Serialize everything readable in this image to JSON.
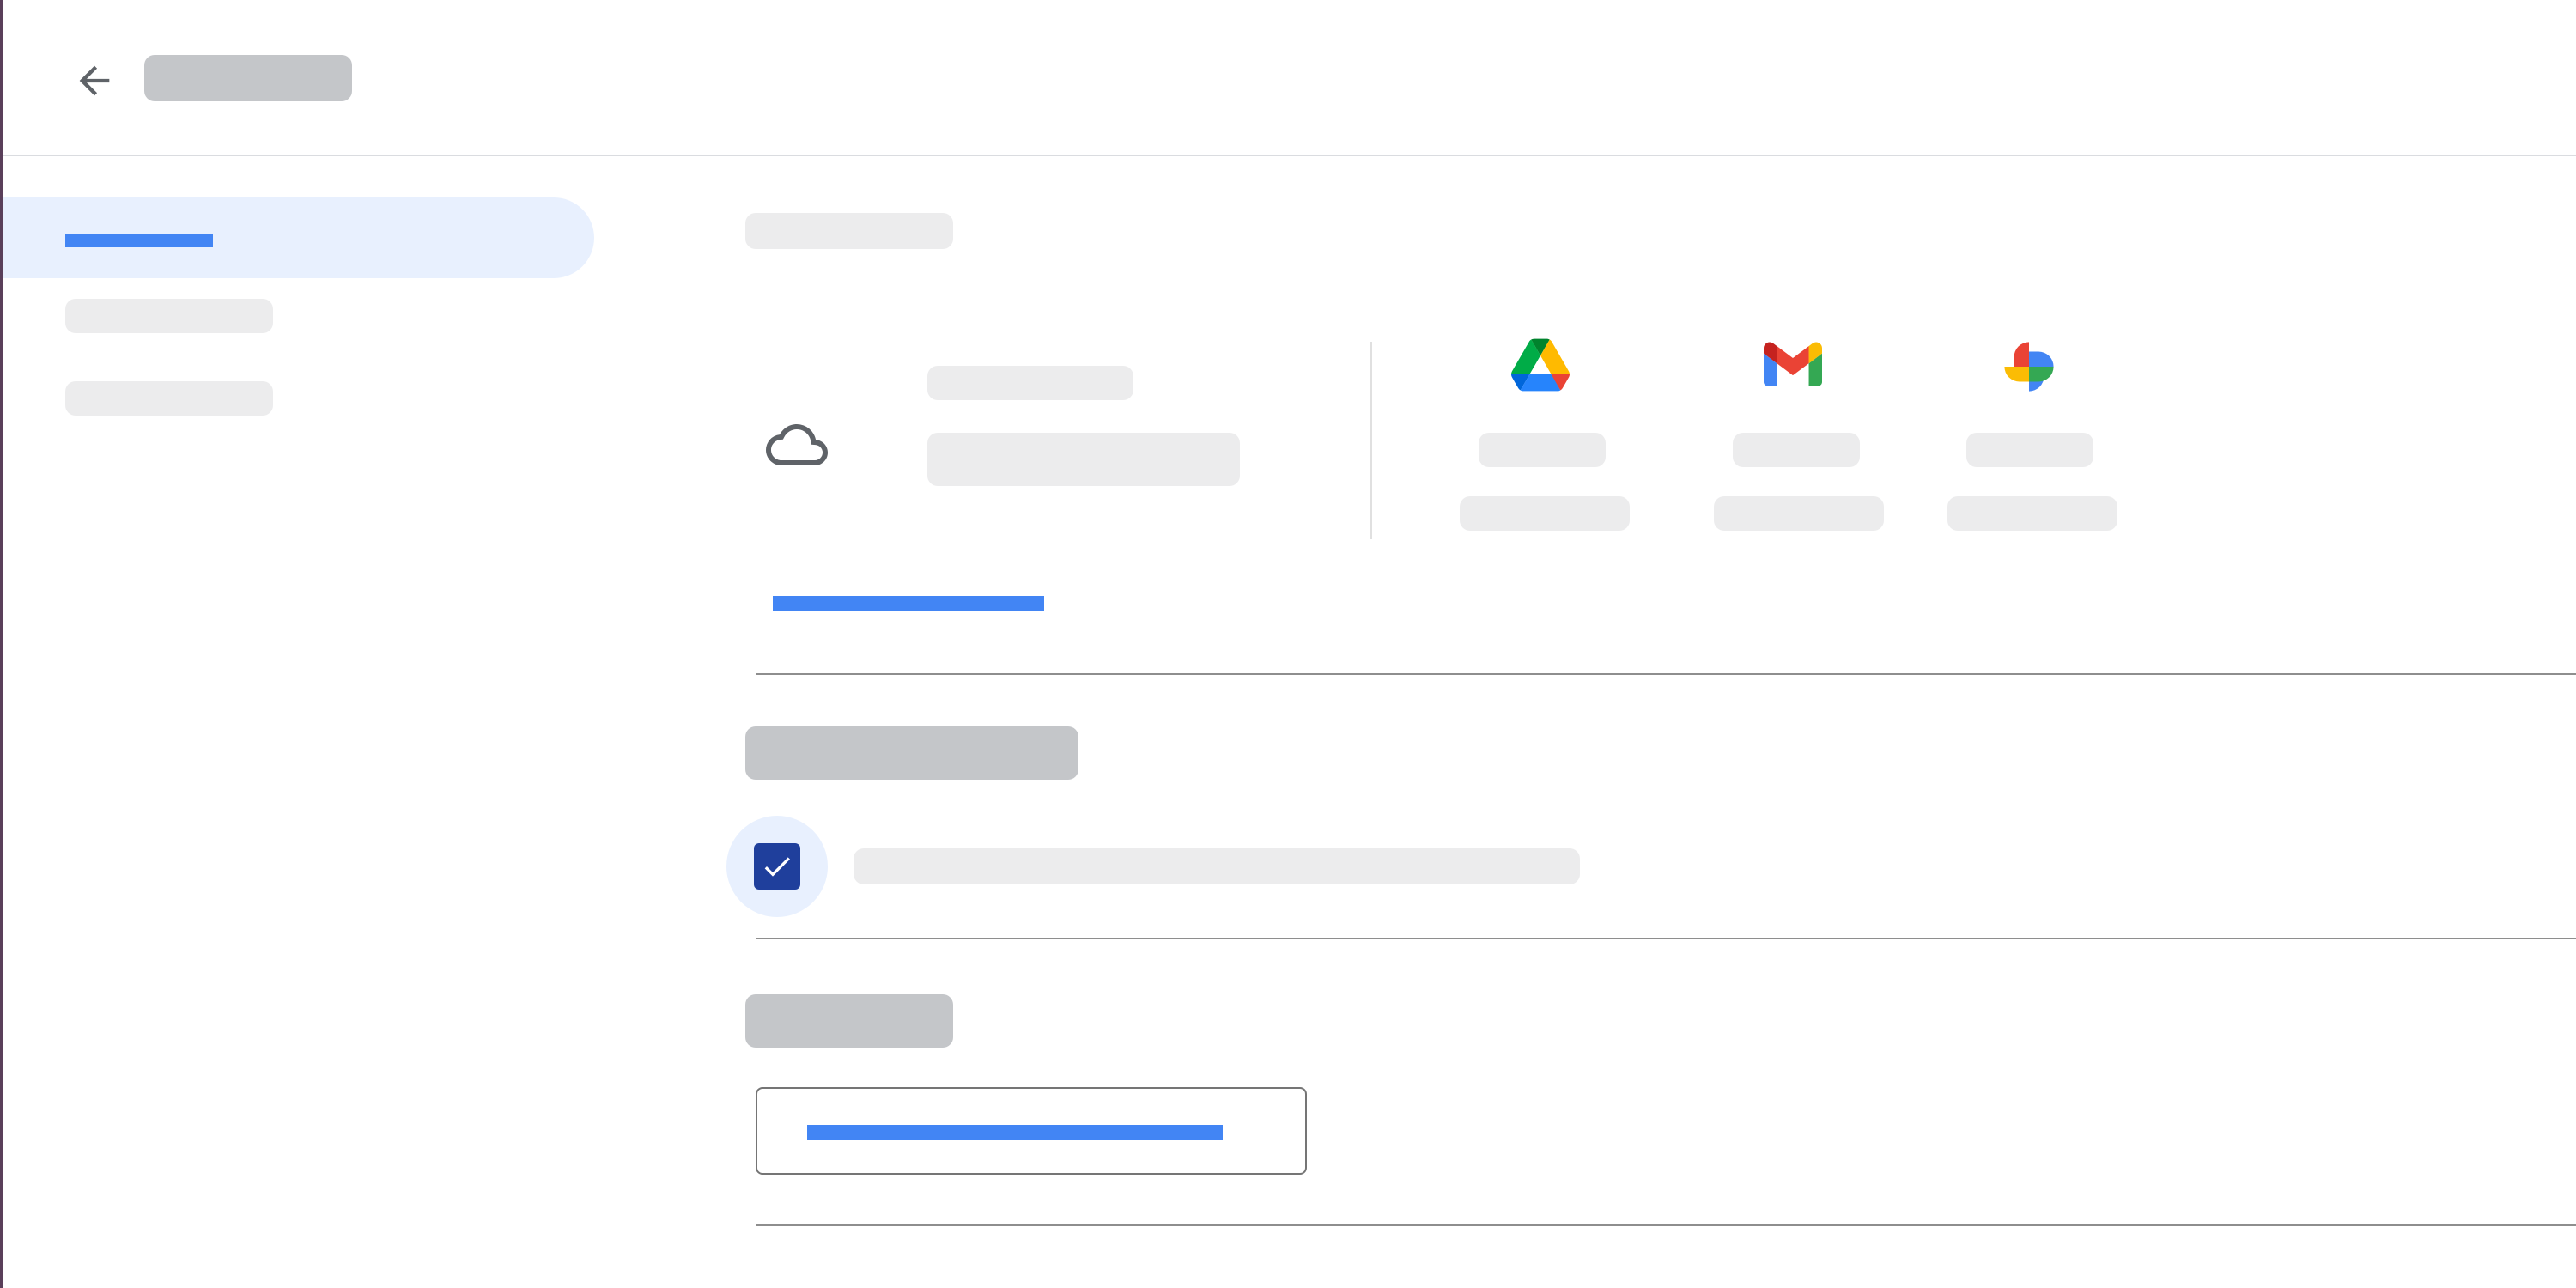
{
  "header": {
    "back_icon": "arrow-back-icon",
    "title": ""
  },
  "sidebar": {
    "items": [
      {
        "label": "",
        "active": true
      },
      {
        "label": "",
        "active": false
      },
      {
        "label": "",
        "active": false
      }
    ]
  },
  "storage": {
    "section_title": "",
    "cloud_icon": "cloud-icon",
    "usage_label": "",
    "usage_value": "",
    "apps": [
      {
        "icon": "google-drive-icon",
        "name": "",
        "usage": ""
      },
      {
        "icon": "gmail-icon",
        "name": "",
        "usage": ""
      },
      {
        "icon": "google-photos-icon",
        "name": "",
        "usage": ""
      }
    ],
    "manage_link": ""
  },
  "backup": {
    "section_title": "",
    "checkbox_checked": true,
    "checkbox_label": ""
  },
  "actions": {
    "section_title": "",
    "button_label": ""
  },
  "colors": {
    "accent": "#4285f4",
    "nav_active_bg": "#e8f0fe",
    "checkbox_fill": "#1f3f9c",
    "skeleton_dark": "#c4c6c9",
    "skeleton_light": "#ececed"
  }
}
